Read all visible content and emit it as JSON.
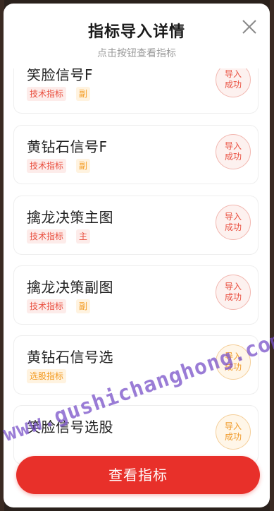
{
  "modal": {
    "title": "指标导入详情",
    "subtitle": "点击按钮查看指标",
    "close_icon": "close-icon"
  },
  "items": [
    {
      "name": "笑脸信号F",
      "tags": [
        "技术指标",
        "副"
      ],
      "status": "导入\n成功",
      "status_color": "red"
    },
    {
      "name": "黄钻石信号F",
      "tags": [
        "技术指标",
        "副"
      ],
      "status": "导入\n成功",
      "status_color": "red"
    },
    {
      "name": "擒龙决策主图",
      "tags": [
        "技术指标",
        "主"
      ],
      "status": "导入\n成功",
      "status_color": "red"
    },
    {
      "name": "擒龙决策副图",
      "tags": [
        "技术指标",
        "副"
      ],
      "status": "导入\n成功",
      "status_color": "red"
    },
    {
      "name": "黄钻石信号选",
      "tags": [
        "选股指标"
      ],
      "status": "导入\n成功",
      "status_color": "orange"
    },
    {
      "name": "笑脸信号选股",
      "tags": [],
      "status": "导入\n成功",
      "status_color": "orange"
    }
  ],
  "cta": {
    "label": "查看指标"
  },
  "watermark": "www.gushichanghong.com",
  "colors": {
    "accent": "#e8302a",
    "tag_red": "#e94f3f",
    "tag_orange": "#f39a1f"
  }
}
